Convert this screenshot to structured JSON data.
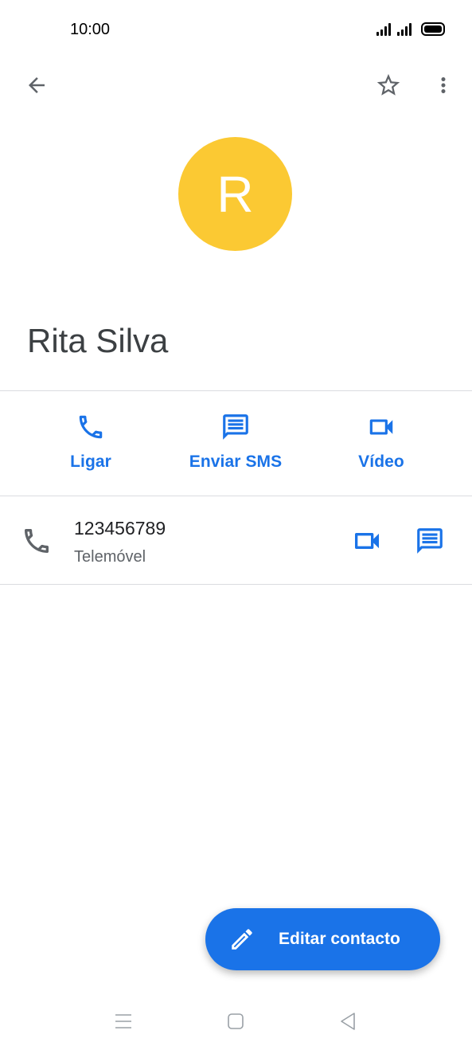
{
  "status_bar": {
    "time": "10:00"
  },
  "toolbar": {
    "back_icon": "arrow-left-icon",
    "favorite_icon": "star-outline-icon",
    "more_icon": "more-vert-icon"
  },
  "contact": {
    "initial": "R",
    "avatar_color": "#fbc933",
    "name": "Rita Silva"
  },
  "actions": [
    {
      "label": "Ligar",
      "icon": "phone-icon"
    },
    {
      "label": "Enviar SMS",
      "icon": "message-icon"
    },
    {
      "label": "Vídeo",
      "icon": "videocam-icon"
    }
  ],
  "phone_entry": {
    "number": "123456789",
    "type": "Telemóvel"
  },
  "fab": {
    "label": "Editar contacto",
    "icon": "pencil-icon"
  },
  "colors": {
    "accent": "#1a73e8",
    "divider": "#dadce0",
    "secondary_text": "#5f6368"
  }
}
